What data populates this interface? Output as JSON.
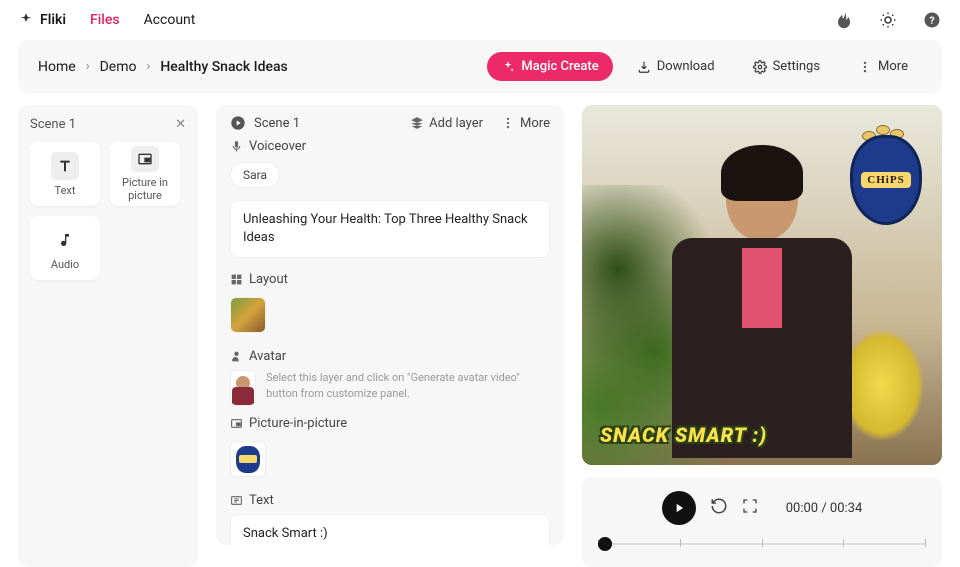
{
  "topnav": {
    "brand": "Fliki",
    "links": [
      "Files",
      "Account"
    ],
    "active_index": 0
  },
  "breadcrumbs": [
    "Home",
    "Demo",
    "Healthy Snack Ideas"
  ],
  "actions": {
    "magic": "Magic Create",
    "download": "Download",
    "settings": "Settings",
    "more": "More"
  },
  "left_panel": {
    "title": "Scene 1",
    "tiles": [
      {
        "label": "Text",
        "icon": "text"
      },
      {
        "label": "Picture in picture",
        "icon": "pip"
      },
      {
        "label": "Audio",
        "icon": "audio"
      }
    ]
  },
  "mid_panel": {
    "scene_label": "Scene 1",
    "add_layer": "Add layer",
    "more": "More",
    "voiceover_label": "Voiceover",
    "voice_chip": "Sara",
    "script_text": "Unleashing Your Health: Top Three Healthy Snack Ideas",
    "layout_label": "Layout",
    "avatar_label": "Avatar",
    "avatar_hint": "Select this layer and click on \"Generate avatar video\" button from customize panel.",
    "pip_label": "Picture-in-picture",
    "text_label": "Text",
    "text_value": "Snack Smart :)"
  },
  "preview": {
    "caption": "SNACK SMART :)",
    "chips_label": "CHiPS"
  },
  "controls": {
    "time_current": "00:00",
    "time_total": "00:34"
  }
}
